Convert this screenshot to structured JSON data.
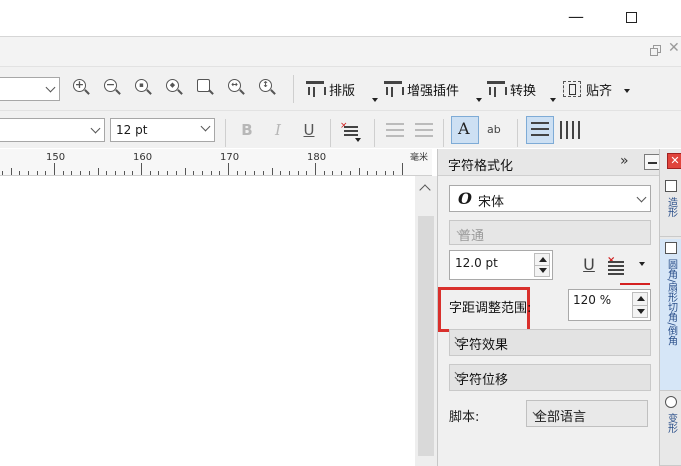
{
  "window": {
    "minimize_glyph": "—",
    "close_glyph": "✕"
  },
  "toolbar": {
    "layout_label": "排版",
    "enhance_label": "增强插件",
    "convert_label": "转换",
    "snap_label": "贴齐",
    "zoom_tools": [
      "zoom-in-icon",
      "zoom-out-icon",
      "zoom-selected-icon",
      "zoom-all-icon",
      "zoom-page-icon",
      "zoom-width-icon",
      "zoom-height-icon"
    ]
  },
  "format_bar": {
    "font_size": "12 pt",
    "bold": "B",
    "italic": "I",
    "underline": "U",
    "shape_text_label": "ab"
  },
  "ruler": {
    "labels": [
      "150",
      "160",
      "170",
      "180"
    ],
    "unit": "毫米"
  },
  "docker": {
    "title": "字符格式化",
    "expand_glyph": "»",
    "font_glyph": "O",
    "font_name": "宋体",
    "font_style": "普通",
    "font_size": "12.0 pt",
    "underline_glyph": "U",
    "spacing_label": "字距调整范围:",
    "spacing_value": "120 %",
    "effects_label": "字符效果",
    "shift_label": "字符位移",
    "script_label": "脚本:",
    "script_value": "全部语言",
    "close_glyph": "✕",
    "side_tabs": [
      "造形",
      "圆角/扇形切角/倒角",
      "变形"
    ]
  },
  "colors": {
    "highlight_red": "#d9302c",
    "active_blue": "#cde0f3"
  }
}
